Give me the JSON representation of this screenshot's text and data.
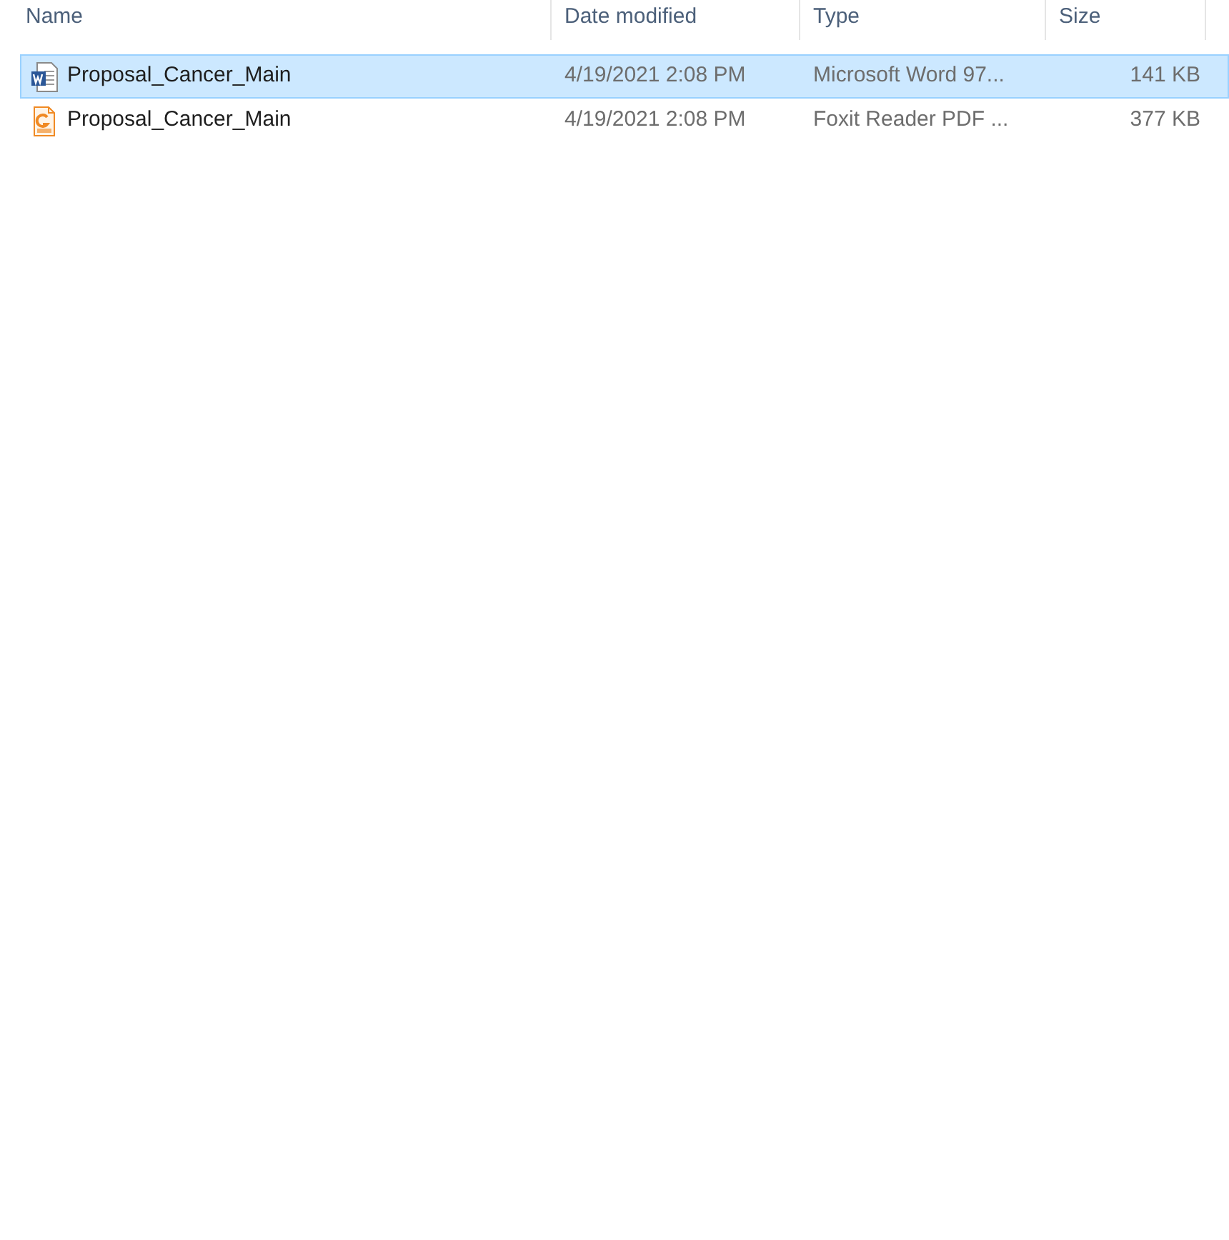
{
  "columns": [
    "Name",
    "Date modified",
    "Type",
    "Size"
  ],
  "files": [
    {
      "kind": "word",
      "name": "Proposal_Cancer_Main",
      "date_modified": "4/19/2021 2:08 PM",
      "type": "Microsoft Word 97...",
      "size": "141 KB",
      "selected": true
    },
    {
      "kind": "pdf",
      "name": "Proposal_Cancer_Main",
      "date_modified": "4/19/2021 2:08 PM",
      "type": "Foxit Reader PDF ...",
      "size": "377 KB",
      "selected": false
    }
  ]
}
